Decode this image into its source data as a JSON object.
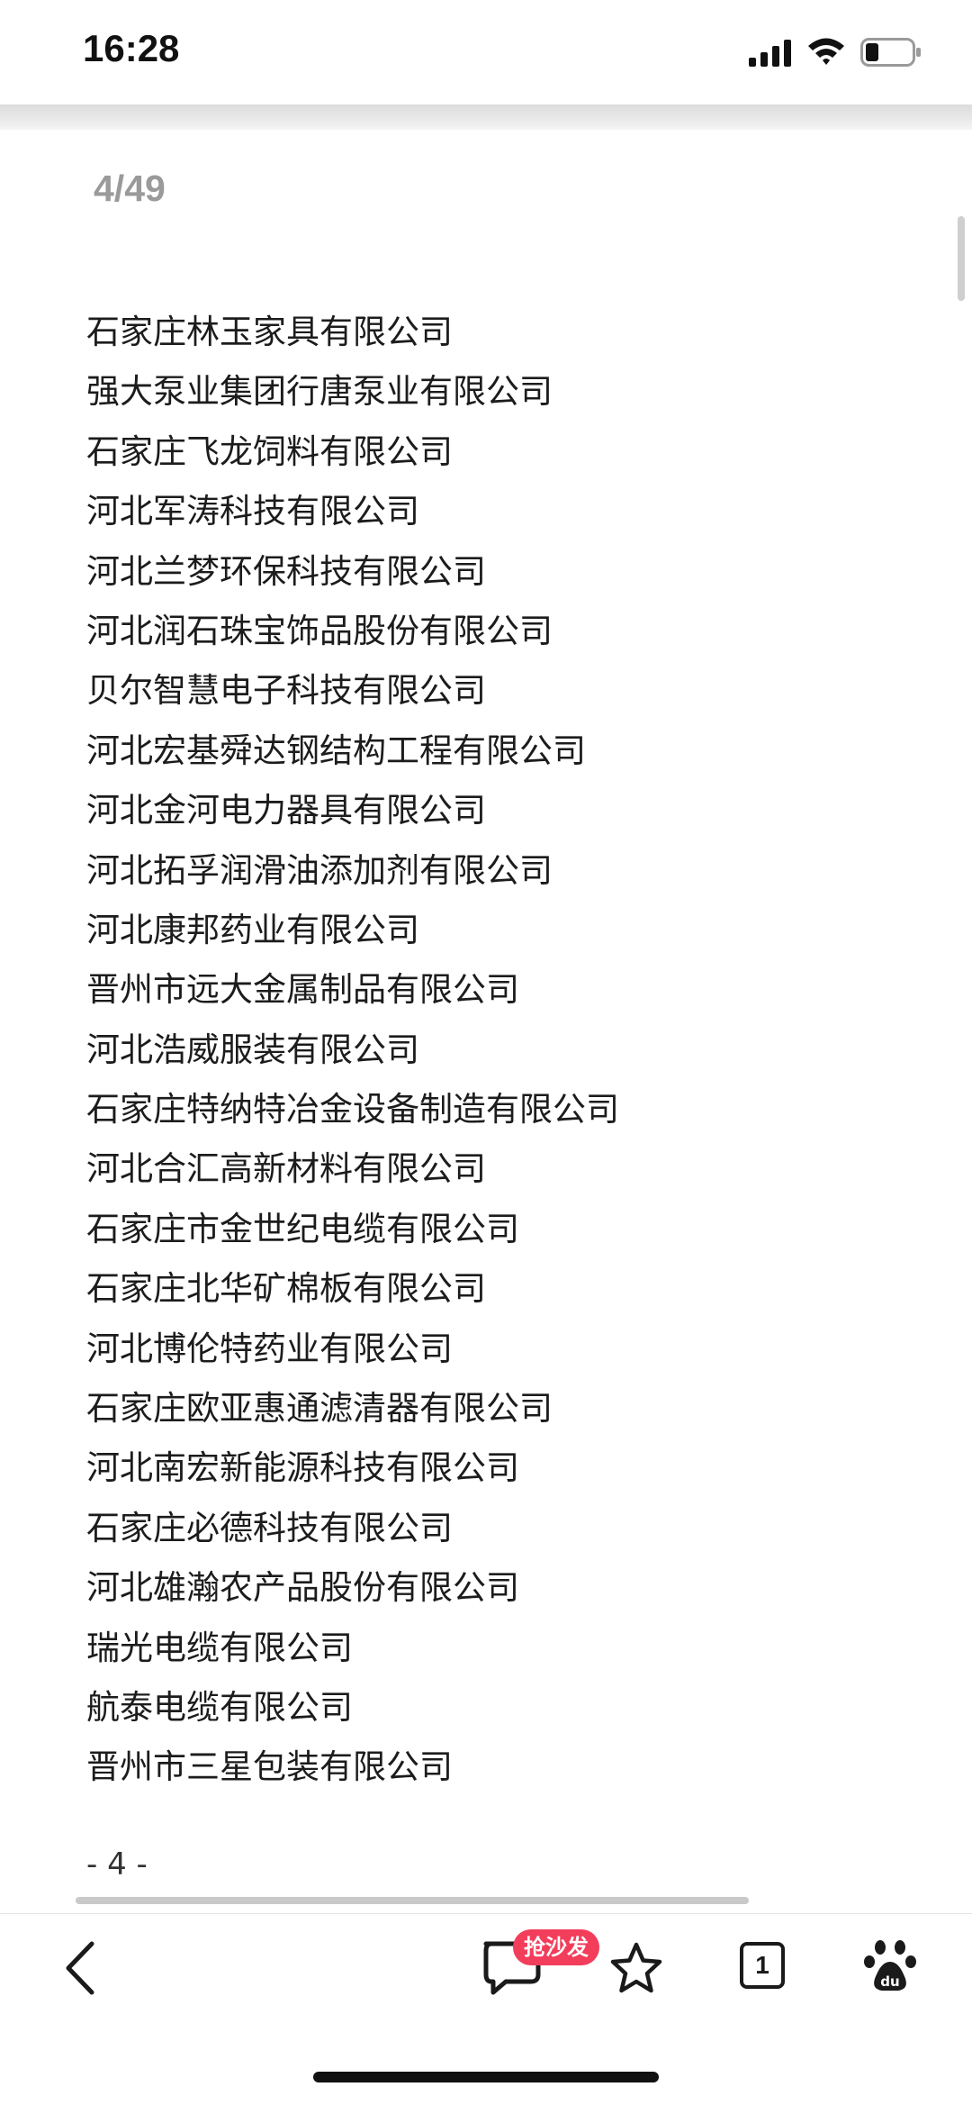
{
  "status_bar": {
    "time": "16:28"
  },
  "document": {
    "page_counter": "4/49",
    "companies": [
      "石家庄林玉家具有限公司",
      "强大泵业集团行唐泵业有限公司",
      "石家庄飞龙饲料有限公司",
      "河北军涛科技有限公司",
      "河北兰梦环保科技有限公司",
      "河北润石珠宝饰品股份有限公司",
      "贝尔智慧电子科技有限公司",
      "河北宏基舜达钢结构工程有限公司",
      "河北金河电力器具有限公司",
      "河北拓孚润滑油添加剂有限公司",
      "河北康邦药业有限公司",
      "晋州市远大金属制品有限公司",
      "河北浩威服装有限公司",
      "石家庄特纳特冶金设备制造有限公司",
      "河北合汇高新材料有限公司",
      "石家庄市金世纪电缆有限公司",
      "石家庄北华矿棉板有限公司",
      "河北博伦特药业有限公司",
      "石家庄欧亚惠通滤清器有限公司",
      "河北南宏新能源科技有限公司",
      "石家庄必德科技有限公司",
      "河北雄瀚农产品股份有限公司",
      "瑞光电缆有限公司",
      "航泰电缆有限公司",
      "晋州市三星包装有限公司"
    ],
    "page_number": "- 4 -"
  },
  "bottom_bar": {
    "sofa_badge": "抢沙发",
    "tab_count": "1",
    "icons": [
      "back-icon",
      "comment-icon",
      "star-icon",
      "tabs-icon",
      "baidu-paw-icon"
    ]
  }
}
